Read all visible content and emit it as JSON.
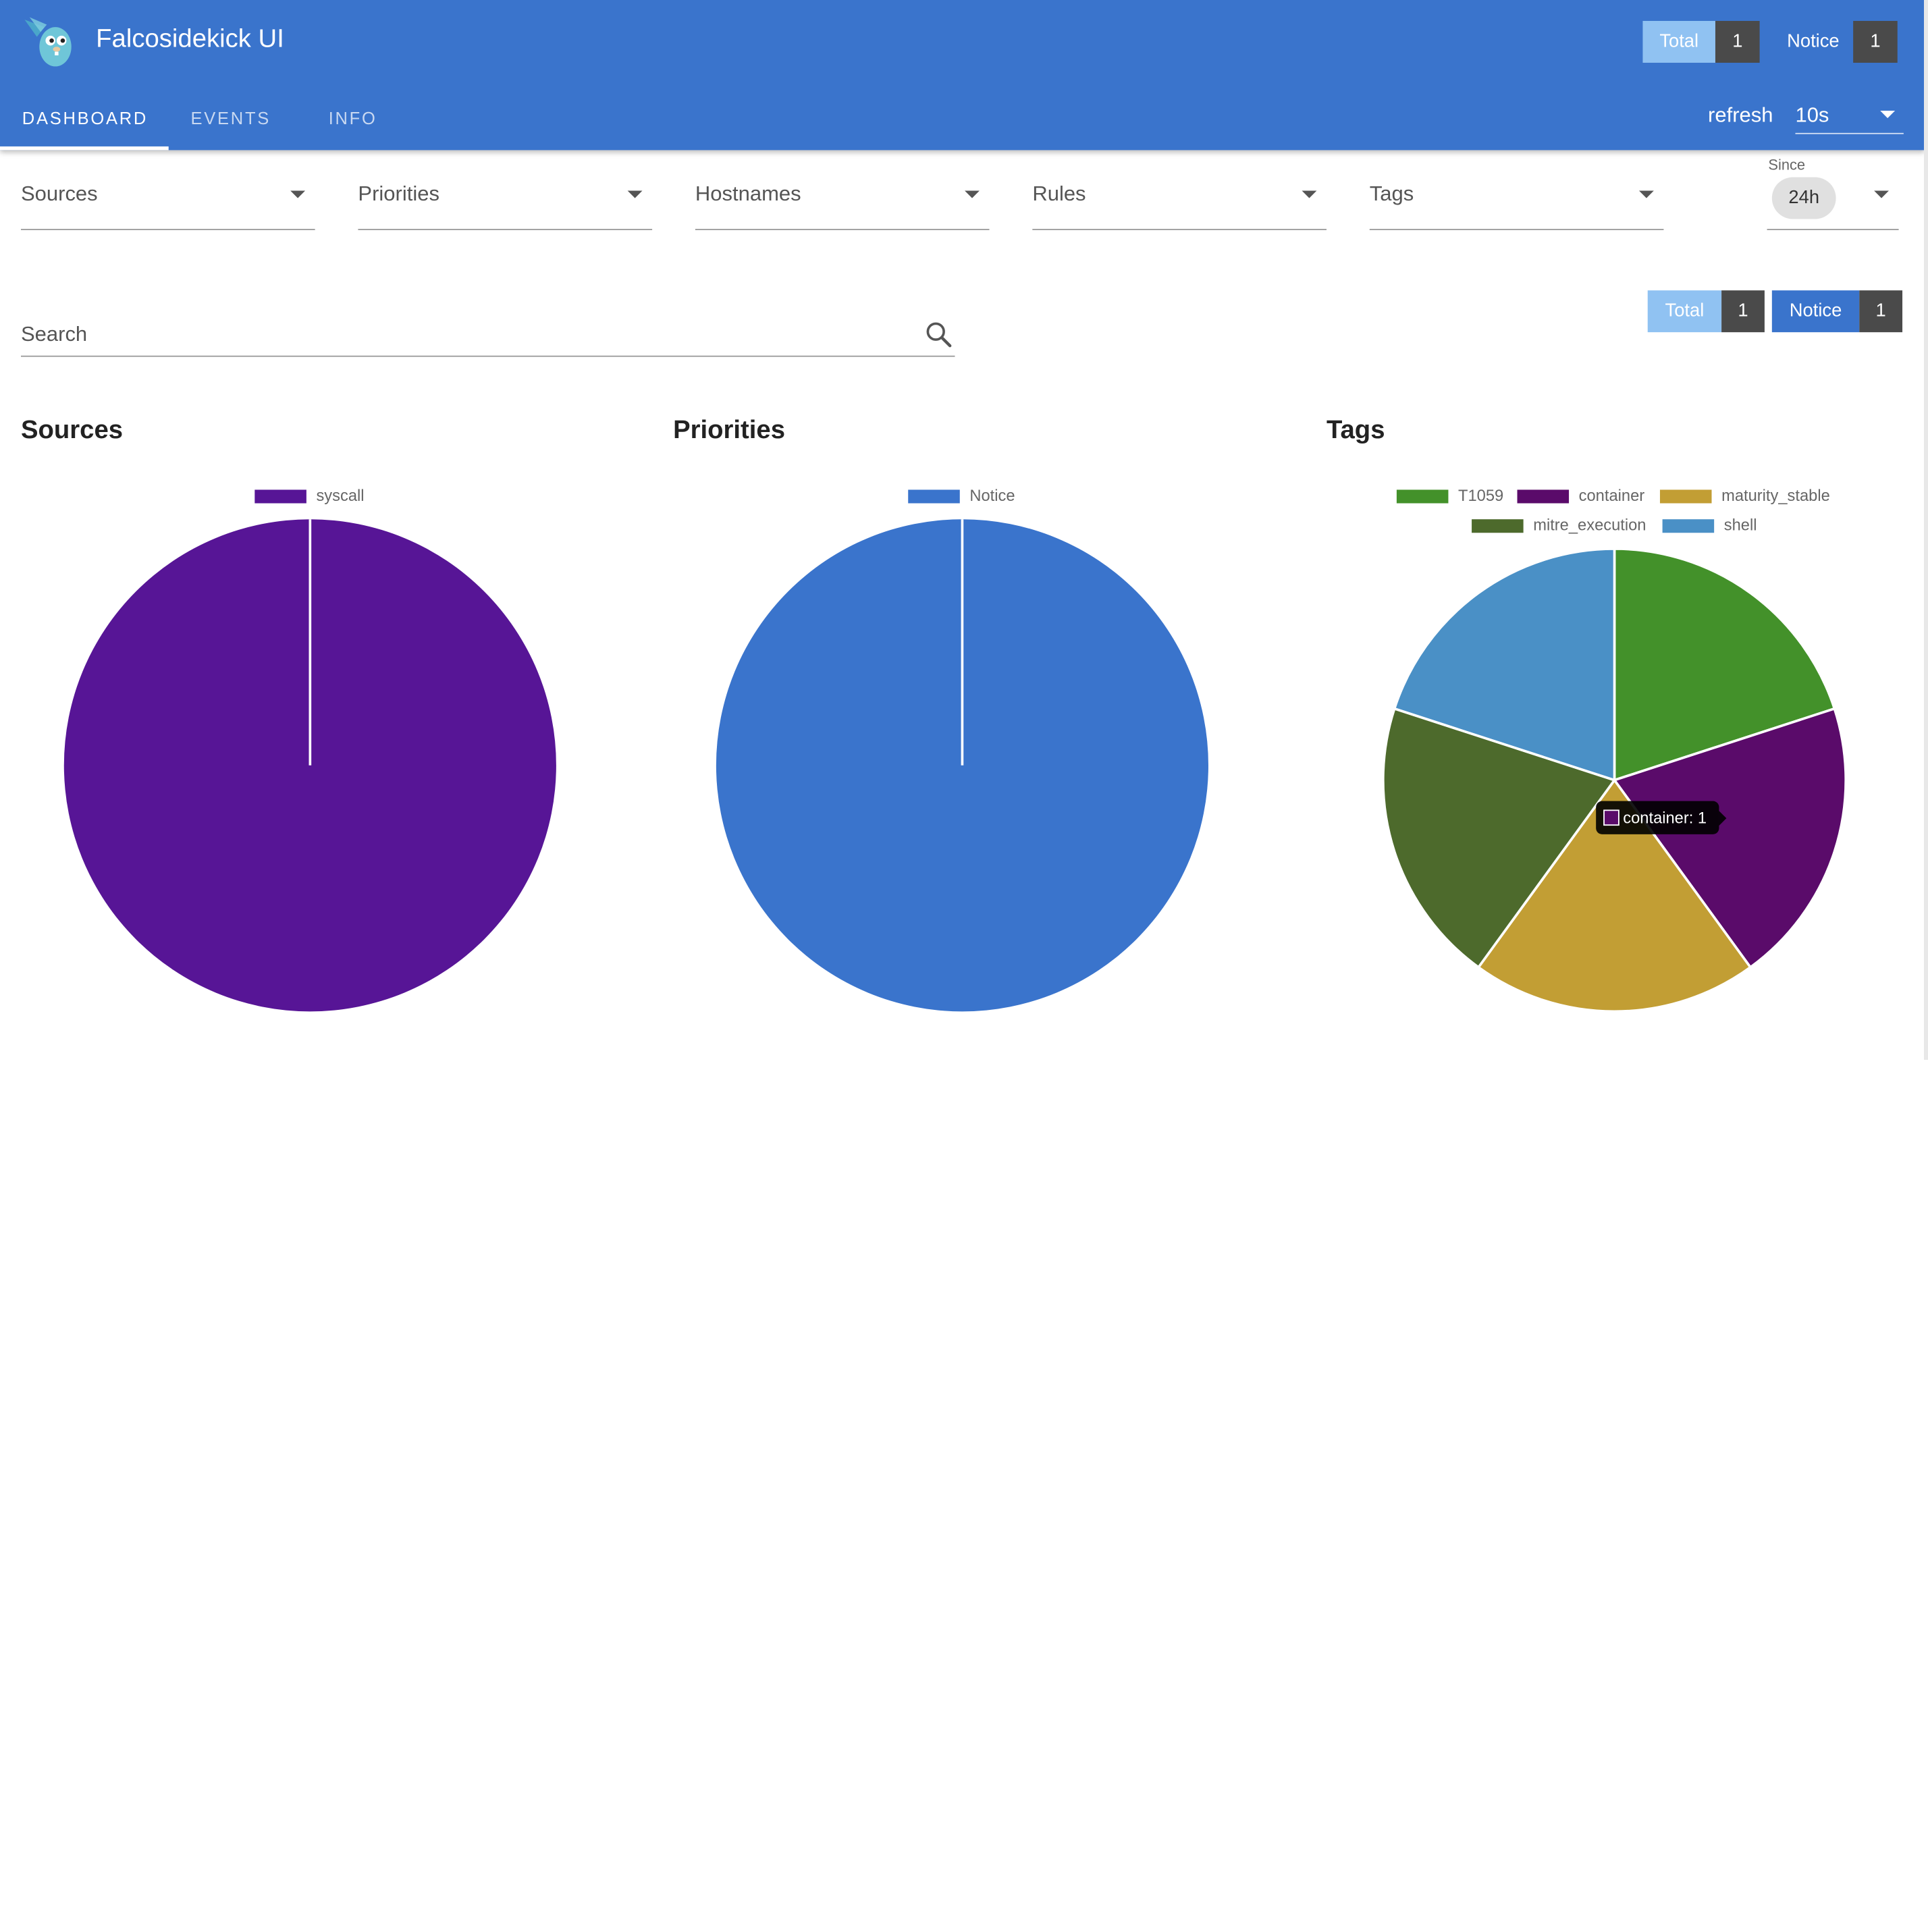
{
  "app": {
    "title": "Falcosidekick UI"
  },
  "header_counts": {
    "total_label": "Total",
    "total_value": "1",
    "notice_label": "Notice",
    "notice_value": "1"
  },
  "tabs": [
    "DASHBOARD",
    "EVENTS",
    "INFO"
  ],
  "refresh": {
    "label": "refresh",
    "value": "10s"
  },
  "filters": [
    "Sources",
    "Priorities",
    "Hostnames",
    "Rules",
    "Tags"
  ],
  "since": {
    "label": "Since",
    "value": "24h"
  },
  "search": {
    "label": "Search"
  },
  "counts": {
    "total_label": "Total",
    "total_value": "1",
    "notice_label": "Notice",
    "notice_value": "1"
  },
  "sections": {
    "sources": "Sources",
    "priorities": "Priorities",
    "tags": "Tags"
  },
  "tooltip": {
    "text": "container: 1"
  },
  "icons": {
    "logo": "falco-gopher-logo",
    "search": "search-icon",
    "dropdown": "arrow-drop-down-icon"
  },
  "colors": {
    "header": "#3a74cc",
    "total_chip": "#90c2f2",
    "count_chip": "#4a4a4a",
    "notice_chip": "#3a74cc"
  },
  "chart_data": [
    {
      "type": "pie",
      "title": "Sources",
      "categories": [
        "syscall"
      ],
      "values": [
        1
      ],
      "colors": [
        "#571596"
      ],
      "legend": "top"
    },
    {
      "type": "pie",
      "title": "Priorities",
      "categories": [
        "Notice"
      ],
      "values": [
        1
      ],
      "colors": [
        "#3a74cc"
      ],
      "legend": "top"
    },
    {
      "type": "pie",
      "title": "Tags",
      "categories": [
        "T1059",
        "container",
        "maturity_stable",
        "mitre_execution",
        "shell"
      ],
      "values": [
        1,
        1,
        1,
        1,
        1
      ],
      "slice_order": [
        "T1059",
        "container",
        "maturity_stable",
        "mitre_execution",
        "shell"
      ],
      "colors": [
        "#43912a",
        "#5a0b6a",
        "#c29e34",
        "#4d6a2c",
        "#4a90c6"
      ],
      "legend": "top"
    }
  ]
}
